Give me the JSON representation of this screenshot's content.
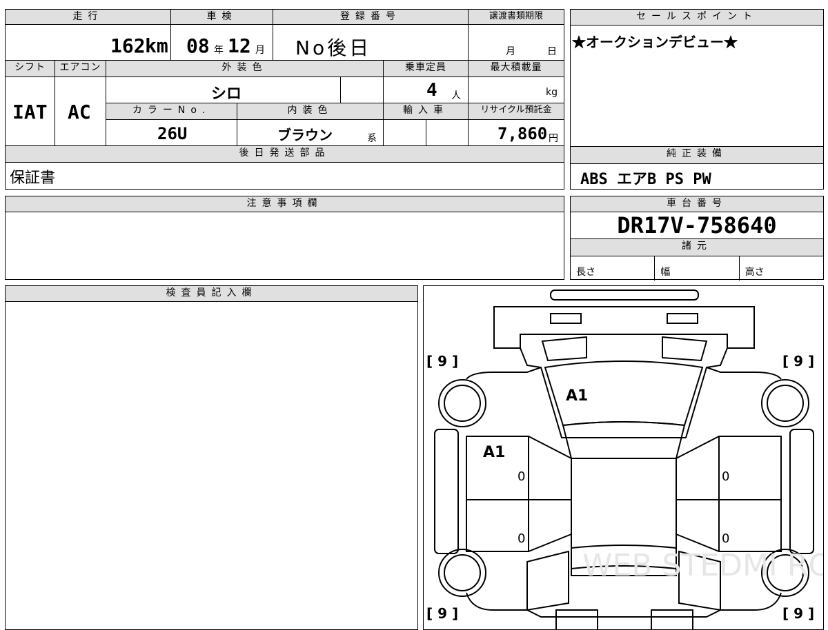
{
  "top": {
    "h_mileage": "走行",
    "mileage_value": "162",
    "mileage_unit": "km",
    "h_inspection": "車検",
    "insp_year": "08",
    "insp_year_unit": "年",
    "insp_month": "12",
    "insp_month_unit": "月",
    "h_regno": "登録番号",
    "regno_value": "No後日",
    "h_doc_deadline": "譲渡書類期限",
    "doc_month": "月",
    "doc_day": "日",
    "h_shift": "シフト",
    "shift_value": "IAT",
    "h_ac": "エアコン",
    "ac_value": "AC",
    "h_ext_color": "外装色",
    "ext_color_value": "シロ",
    "h_capacity": "乗車定員",
    "capacity_value": "4",
    "capacity_unit": "人",
    "h_max_load": "最大積載量",
    "max_load_unit": "kg",
    "h_color_no": "カラーNo.",
    "color_no_value": "26U",
    "h_int_color": "内装色",
    "int_color_value": "ブラウン",
    "int_color_suffix": "系",
    "h_import": "輸入車",
    "h_recycle": "リサイクル預託金",
    "recycle_value": "7,860",
    "recycle_unit": "円",
    "h_later_parts": "後日発送部品",
    "later_parts_value": "保証書"
  },
  "sales": {
    "header": "セールスポイント",
    "text": "★オークションデビュー★"
  },
  "equipment": {
    "header": "純正装備",
    "text": "ABS エアB PS PW"
  },
  "notes": {
    "header": "注意事項欄"
  },
  "chassis": {
    "header": "車台番号",
    "value": "DR17V-758640",
    "spec_header": "諸元",
    "length": "長さ",
    "width": "幅",
    "height": "高さ"
  },
  "inspector": {
    "header": "検査員記入欄"
  },
  "diagram": {
    "tire_tl": "[ 9 ]",
    "tire_tr": "[ 9 ]",
    "tire_bl": "[ 9 ]",
    "tire_br": "[ 9 ]",
    "mark_windshield": "A1",
    "mark_front_left_door": "A1",
    "zero_1": "0",
    "zero_2": "0",
    "zero_3": "0",
    "zero_4": "0",
    "watermark": "WEB STEDMI RO"
  }
}
